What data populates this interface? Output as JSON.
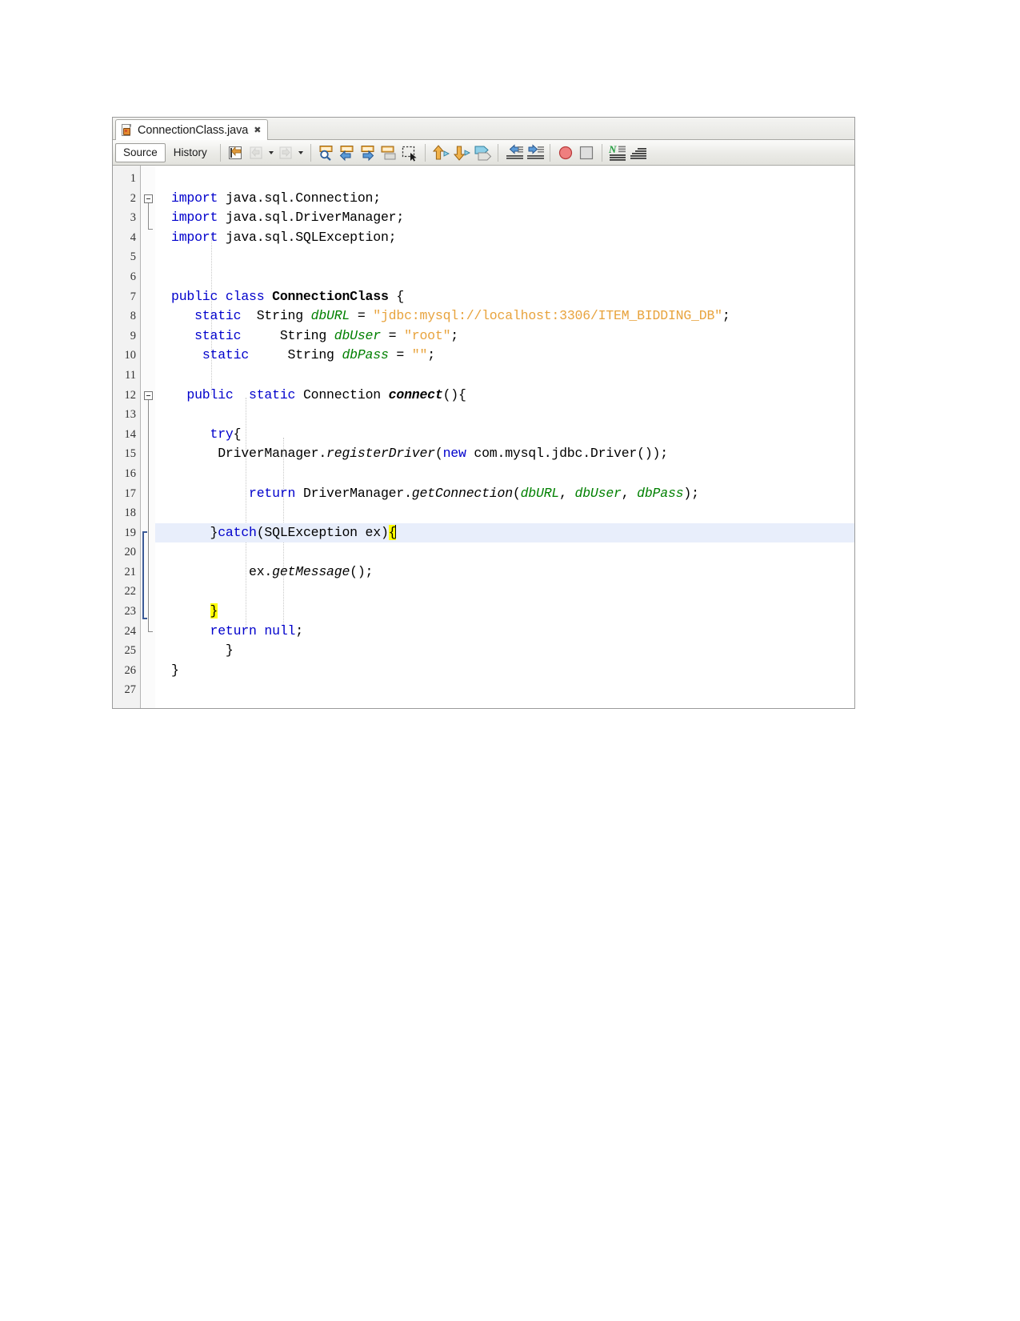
{
  "window": {
    "tab": {
      "label": "ConnectionClass.java",
      "close_glyph": "✖",
      "file_icon": "java-file-icon"
    }
  },
  "toolbar": {
    "source_label": "Source",
    "history_label": "History",
    "buttons": [
      {
        "name": "last-edit-button",
        "icon": "last-edit-icon"
      },
      {
        "name": "back-button",
        "icon": "navigate-back-icon"
      },
      {
        "name": "back-dropdown",
        "icon": "chevron-down-icon"
      },
      {
        "name": "forward-button",
        "icon": "navigate-forward-icon"
      },
      {
        "name": "forward-dropdown",
        "icon": "chevron-down-icon"
      },
      {
        "name": "find-selection-button",
        "icon": "find-magnifier-icon"
      },
      {
        "name": "find-previous-button",
        "icon": "find-previous-icon"
      },
      {
        "name": "find-next-button",
        "icon": "find-next-icon"
      },
      {
        "name": "toggle-highlight-button",
        "icon": "toggle-highlight-icon"
      },
      {
        "name": "toggle-rectangular-selection-button",
        "icon": "rectangular-selection-icon"
      },
      {
        "name": "previous-bookmark-button",
        "icon": "arrow-up-tag-icon"
      },
      {
        "name": "next-bookmark-button",
        "icon": "arrow-down-tag-icon"
      },
      {
        "name": "toggle-bookmark-button",
        "icon": "bookmark-tag-icon"
      },
      {
        "name": "shift-left-button",
        "icon": "shift-line-left-icon"
      },
      {
        "name": "shift-right-button",
        "icon": "shift-line-right-icon"
      },
      {
        "name": "toggle-breakpoint-button",
        "icon": "breakpoint-circle-icon"
      },
      {
        "name": "stop-button",
        "icon": "stop-square-icon"
      },
      {
        "name": "toggle-non-printable-button",
        "icon": "non-printable-chars-icon"
      },
      {
        "name": "toggle-line-wrap-button",
        "icon": "line-wrap-icon"
      }
    ]
  },
  "editor": {
    "current_line": 19,
    "total_lines": 27,
    "line_numbers": [
      1,
      2,
      3,
      4,
      5,
      6,
      7,
      8,
      9,
      10,
      11,
      12,
      13,
      14,
      15,
      16,
      17,
      18,
      19,
      20,
      21,
      22,
      23,
      24,
      25,
      26,
      27
    ],
    "code_lines": [
      {
        "n": 1,
        "text": ""
      },
      {
        "n": 2,
        "text": "import java.sql.Connection;"
      },
      {
        "n": 3,
        "text": "import java.sql.DriverManager;"
      },
      {
        "n": 4,
        "text": "import java.sql.SQLException;"
      },
      {
        "n": 5,
        "text": ""
      },
      {
        "n": 6,
        "text": ""
      },
      {
        "n": 7,
        "text": "public class ConnectionClass {"
      },
      {
        "n": 8,
        "text": "   static  String dbURL = \"jdbc:mysql://localhost:3306/ITEM_BIDDING_DB\";"
      },
      {
        "n": 9,
        "text": "   static     String dbUser = \"root\";"
      },
      {
        "n": 10,
        "text": "    static     String dbPass = \"\";"
      },
      {
        "n": 11,
        "text": ""
      },
      {
        "n": 12,
        "text": "  public  static Connection connect(){"
      },
      {
        "n": 13,
        "text": ""
      },
      {
        "n": 14,
        "text": "     try{"
      },
      {
        "n": 15,
        "text": "      DriverManager.registerDriver(new com.mysql.jdbc.Driver());"
      },
      {
        "n": 16,
        "text": ""
      },
      {
        "n": 17,
        "text": "          return DriverManager.getConnection(dbURL, dbUser, dbPass);"
      },
      {
        "n": 18,
        "text": ""
      },
      {
        "n": 19,
        "text": "     }catch(SQLException ex){"
      },
      {
        "n": 20,
        "text": ""
      },
      {
        "n": 21,
        "text": "          ex.getMessage();"
      },
      {
        "n": 22,
        "text": ""
      },
      {
        "n": 23,
        "text": "     }"
      },
      {
        "n": 24,
        "text": "     return null;"
      },
      {
        "n": 25,
        "text": "       }"
      },
      {
        "n": 26,
        "text": "}"
      },
      {
        "n": 27,
        "text": ""
      }
    ],
    "highlights": {
      "line_19_brace": "{",
      "line_23_brace": "}",
      "highlight_color": "#ffff00",
      "current_line_color": "#e8eefb"
    },
    "colors": {
      "keyword": "#0000cc",
      "string": "#e8a33d",
      "field": "#008000",
      "plain": "#000000",
      "gutter_bg": "#f2f2f2",
      "editor_bg": "#ffffff"
    }
  }
}
